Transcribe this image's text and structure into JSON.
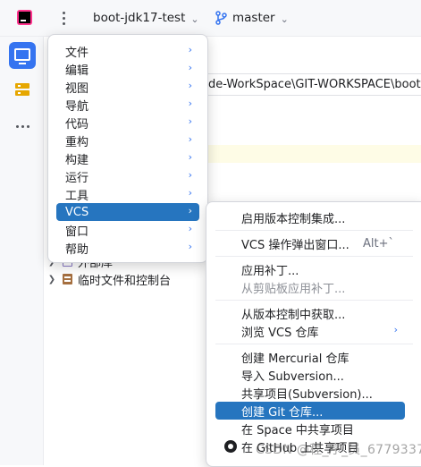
{
  "titlebar": {
    "project_name": "boot-jdk17-test",
    "branch_name": "master"
  },
  "editor": {
    "path_text": "de-WorkSpace\\GIT-WORKSPACE\\boot-",
    "tree": [
      {
        "label": "外部库"
      },
      {
        "label": "临时文件和控制台"
      }
    ]
  },
  "main_menu": {
    "items": [
      {
        "label": "文件"
      },
      {
        "label": "编辑"
      },
      {
        "label": "视图"
      },
      {
        "label": "导航"
      },
      {
        "label": "代码"
      },
      {
        "label": "重构"
      },
      {
        "label": "构建"
      },
      {
        "label": "运行"
      },
      {
        "label": "工具"
      },
      {
        "label": "VCS"
      },
      {
        "label": "窗口"
      },
      {
        "label": "帮助"
      }
    ],
    "selected": "VCS"
  },
  "vcs_menu": {
    "items": [
      {
        "label": "启用版本控制集成..."
      },
      {
        "label": "VCS 操作弹出窗口...",
        "shortcut": "Alt+`"
      },
      {
        "label": "应用补丁..."
      },
      {
        "label": "从剪贴板应用补丁..."
      },
      {
        "label": "从版本控制中获取..."
      },
      {
        "label": "浏览 VCS 仓库"
      },
      {
        "label": "创建 Mercurial 仓库"
      },
      {
        "label": "导入 Subversion..."
      },
      {
        "label": "共享项目(Subversion)..."
      },
      {
        "label": "创建 Git 仓库..."
      },
      {
        "label": "在 Space 中共享项目"
      },
      {
        "label": "在 GitHub 上共享项目"
      }
    ],
    "selected": "创建 Git 仓库..."
  },
  "watermark": "CSDN @程_序_员_6779337"
}
